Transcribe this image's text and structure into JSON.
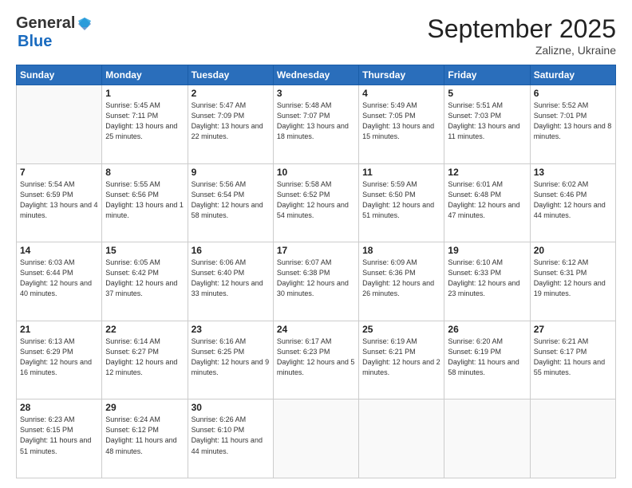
{
  "logo": {
    "general": "General",
    "blue": "Blue"
  },
  "title": "September 2025",
  "subtitle": "Zalizne, Ukraine",
  "days_of_week": [
    "Sunday",
    "Monday",
    "Tuesday",
    "Wednesday",
    "Thursday",
    "Friday",
    "Saturday"
  ],
  "weeks": [
    [
      {
        "day": "",
        "info": ""
      },
      {
        "day": "1",
        "info": "Sunrise: 5:45 AM\nSunset: 7:11 PM\nDaylight: 13 hours\nand 25 minutes."
      },
      {
        "day": "2",
        "info": "Sunrise: 5:47 AM\nSunset: 7:09 PM\nDaylight: 13 hours\nand 22 minutes."
      },
      {
        "day": "3",
        "info": "Sunrise: 5:48 AM\nSunset: 7:07 PM\nDaylight: 13 hours\nand 18 minutes."
      },
      {
        "day": "4",
        "info": "Sunrise: 5:49 AM\nSunset: 7:05 PM\nDaylight: 13 hours\nand 15 minutes."
      },
      {
        "day": "5",
        "info": "Sunrise: 5:51 AM\nSunset: 7:03 PM\nDaylight: 13 hours\nand 11 minutes."
      },
      {
        "day": "6",
        "info": "Sunrise: 5:52 AM\nSunset: 7:01 PM\nDaylight: 13 hours\nand 8 minutes."
      }
    ],
    [
      {
        "day": "7",
        "info": "Sunrise: 5:54 AM\nSunset: 6:59 PM\nDaylight: 13 hours\nand 4 minutes."
      },
      {
        "day": "8",
        "info": "Sunrise: 5:55 AM\nSunset: 6:56 PM\nDaylight: 13 hours\nand 1 minute."
      },
      {
        "day": "9",
        "info": "Sunrise: 5:56 AM\nSunset: 6:54 PM\nDaylight: 12 hours\nand 58 minutes."
      },
      {
        "day": "10",
        "info": "Sunrise: 5:58 AM\nSunset: 6:52 PM\nDaylight: 12 hours\nand 54 minutes."
      },
      {
        "day": "11",
        "info": "Sunrise: 5:59 AM\nSunset: 6:50 PM\nDaylight: 12 hours\nand 51 minutes."
      },
      {
        "day": "12",
        "info": "Sunrise: 6:01 AM\nSunset: 6:48 PM\nDaylight: 12 hours\nand 47 minutes."
      },
      {
        "day": "13",
        "info": "Sunrise: 6:02 AM\nSunset: 6:46 PM\nDaylight: 12 hours\nand 44 minutes."
      }
    ],
    [
      {
        "day": "14",
        "info": "Sunrise: 6:03 AM\nSunset: 6:44 PM\nDaylight: 12 hours\nand 40 minutes."
      },
      {
        "day": "15",
        "info": "Sunrise: 6:05 AM\nSunset: 6:42 PM\nDaylight: 12 hours\nand 37 minutes."
      },
      {
        "day": "16",
        "info": "Sunrise: 6:06 AM\nSunset: 6:40 PM\nDaylight: 12 hours\nand 33 minutes."
      },
      {
        "day": "17",
        "info": "Sunrise: 6:07 AM\nSunset: 6:38 PM\nDaylight: 12 hours\nand 30 minutes."
      },
      {
        "day": "18",
        "info": "Sunrise: 6:09 AM\nSunset: 6:36 PM\nDaylight: 12 hours\nand 26 minutes."
      },
      {
        "day": "19",
        "info": "Sunrise: 6:10 AM\nSunset: 6:33 PM\nDaylight: 12 hours\nand 23 minutes."
      },
      {
        "day": "20",
        "info": "Sunrise: 6:12 AM\nSunset: 6:31 PM\nDaylight: 12 hours\nand 19 minutes."
      }
    ],
    [
      {
        "day": "21",
        "info": "Sunrise: 6:13 AM\nSunset: 6:29 PM\nDaylight: 12 hours\nand 16 minutes."
      },
      {
        "day": "22",
        "info": "Sunrise: 6:14 AM\nSunset: 6:27 PM\nDaylight: 12 hours\nand 12 minutes."
      },
      {
        "day": "23",
        "info": "Sunrise: 6:16 AM\nSunset: 6:25 PM\nDaylight: 12 hours\nand 9 minutes."
      },
      {
        "day": "24",
        "info": "Sunrise: 6:17 AM\nSunset: 6:23 PM\nDaylight: 12 hours\nand 5 minutes."
      },
      {
        "day": "25",
        "info": "Sunrise: 6:19 AM\nSunset: 6:21 PM\nDaylight: 12 hours\nand 2 minutes."
      },
      {
        "day": "26",
        "info": "Sunrise: 6:20 AM\nSunset: 6:19 PM\nDaylight: 11 hours\nand 58 minutes."
      },
      {
        "day": "27",
        "info": "Sunrise: 6:21 AM\nSunset: 6:17 PM\nDaylight: 11 hours\nand 55 minutes."
      }
    ],
    [
      {
        "day": "28",
        "info": "Sunrise: 6:23 AM\nSunset: 6:15 PM\nDaylight: 11 hours\nand 51 minutes."
      },
      {
        "day": "29",
        "info": "Sunrise: 6:24 AM\nSunset: 6:12 PM\nDaylight: 11 hours\nand 48 minutes."
      },
      {
        "day": "30",
        "info": "Sunrise: 6:26 AM\nSunset: 6:10 PM\nDaylight: 11 hours\nand 44 minutes."
      },
      {
        "day": "",
        "info": ""
      },
      {
        "day": "",
        "info": ""
      },
      {
        "day": "",
        "info": ""
      },
      {
        "day": "",
        "info": ""
      }
    ]
  ]
}
